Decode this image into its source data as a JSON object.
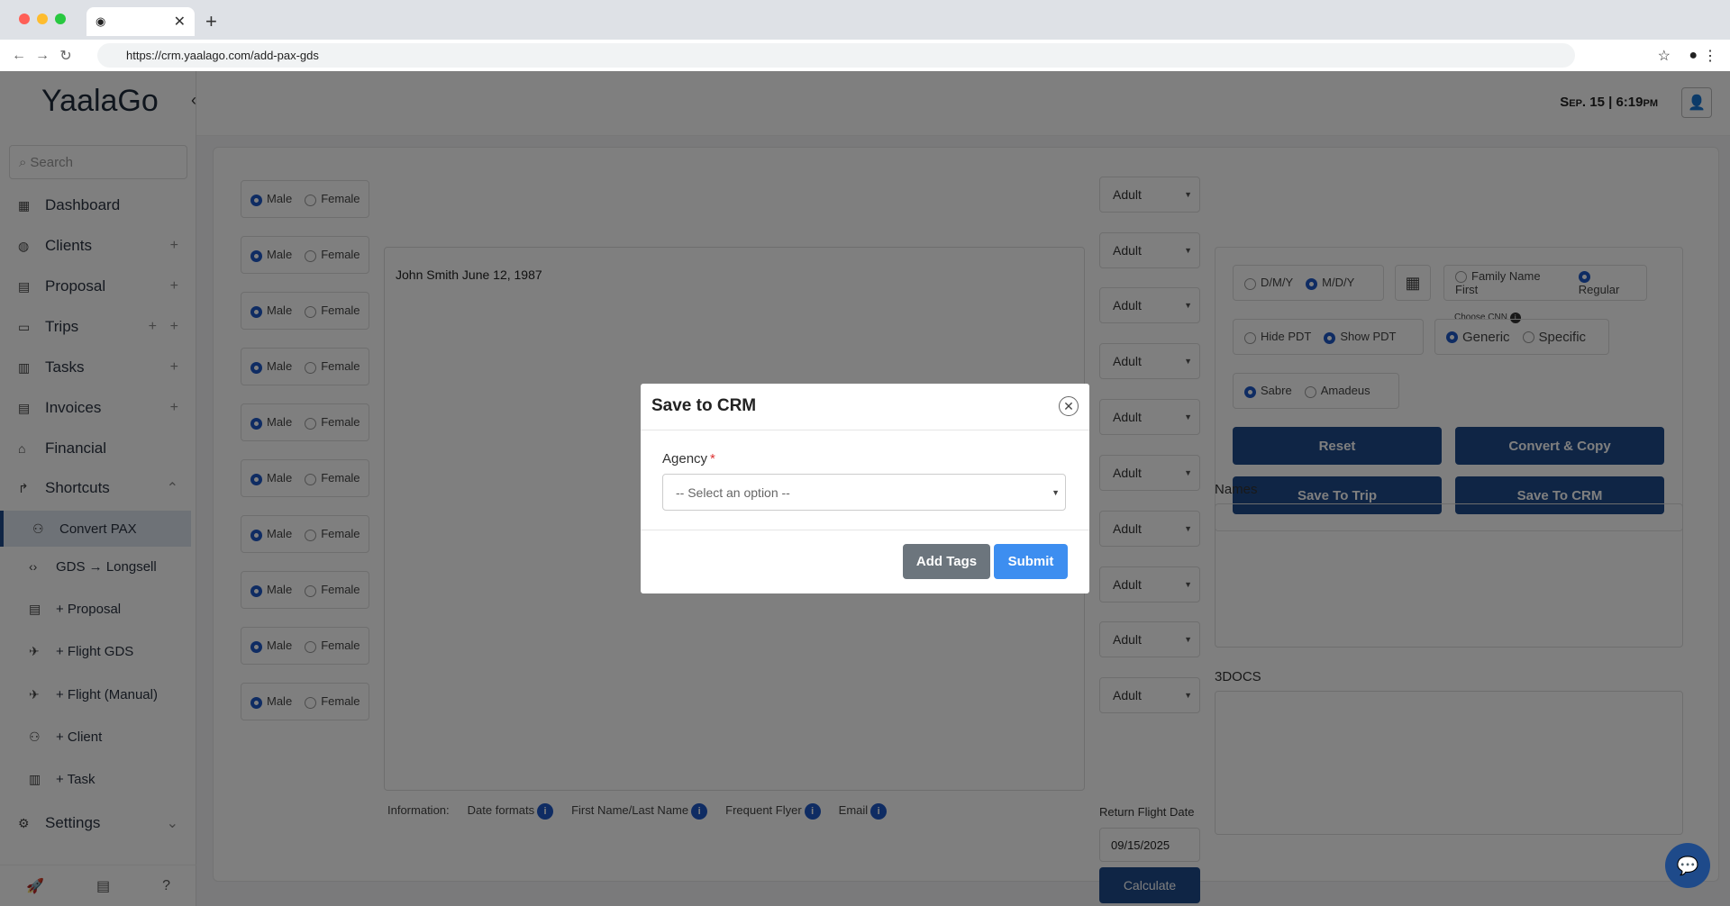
{
  "browser": {
    "url": "https://crm.yaalago.com/add-pax-gds"
  },
  "app": {
    "logo": "YaalaGo",
    "datetime": "Sep. 15 | 6:19pm"
  },
  "sidebar": {
    "search_placeholder": "Search",
    "items": [
      {
        "label": "Dashboard"
      },
      {
        "label": "Clients"
      },
      {
        "label": "Proposal"
      },
      {
        "label": "Trips"
      },
      {
        "label": "Tasks"
      },
      {
        "label": "Invoices"
      },
      {
        "label": "Financial"
      },
      {
        "label": "Shortcuts"
      }
    ],
    "shortcuts": [
      {
        "label": "Convert PAX"
      },
      {
        "label": "GDS → Longsell"
      },
      {
        "label": "+ Proposal"
      },
      {
        "label": "+ Flight GDS"
      },
      {
        "label": "+ Flight (Manual)"
      },
      {
        "label": "+ Client"
      },
      {
        "label": "+ Task"
      }
    ],
    "settings": "Settings"
  },
  "form": {
    "gender_male": "Male",
    "gender_female": "Female",
    "pax_text": "John Smith June 12, 1987",
    "pax_type": "Adult",
    "info": {
      "label": "Information:",
      "date_formats": "Date formats",
      "name": "First Name/Last Name",
      "ff": "Frequent Flyer",
      "email": "Email"
    },
    "return_flight_label": "Return Flight Date",
    "return_flight_value": "09/15/2025",
    "calculate": "Calculate"
  },
  "options": {
    "dmy": "D/M/Y",
    "mdy": "M/D/Y",
    "family_first": "Family Name First",
    "regular": "Regular",
    "hide_pdt": "Hide PDT",
    "show_pdt": "Show PDT",
    "choose_cnn": "Choose CNN",
    "generic": "Generic",
    "specific": "Specific",
    "sabre": "Sabre",
    "amadeus": "Amadeus",
    "reset": "Reset",
    "convert_copy": "Convert & Copy",
    "save_trip": "Save To Trip",
    "save_crm": "Save To CRM",
    "names_label": "Names",
    "docs_label": "3DOCS"
  },
  "modal": {
    "title": "Save to CRM",
    "agency_label": "Agency",
    "required_mark": "*",
    "agency_placeholder": "-- Select an option --",
    "add_tags": "Add Tags",
    "submit": "Submit"
  }
}
